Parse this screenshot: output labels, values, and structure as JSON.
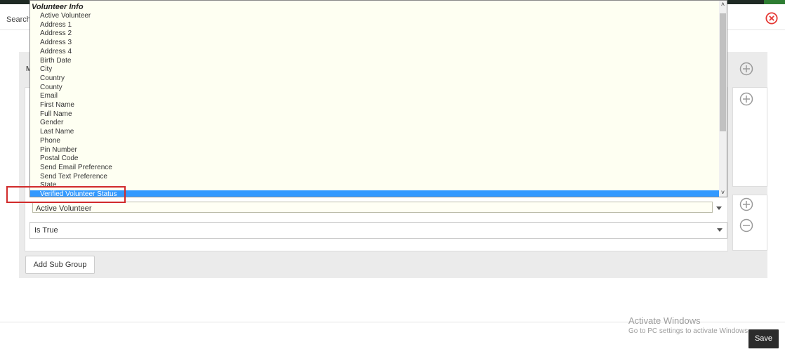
{
  "header": {
    "search_label": "Search",
    "close_color": "#e53935"
  },
  "panel": {
    "letter": "M"
  },
  "dropdown": {
    "group_label": "Volunteer Info",
    "items": [
      "Active Volunteer",
      "Address 1",
      "Address 2",
      "Address 3",
      "Address 4",
      "Birth Date",
      "City",
      "Country",
      "County",
      "Email",
      "First Name",
      "Full Name",
      "Gender",
      "Last Name",
      "Phone",
      "Pin Number",
      "Postal Code",
      "Send Email Preference",
      "Send Text Preference",
      "State",
      "Verified Volunteer Status"
    ],
    "selected_index": 20,
    "selected_color": "#3399ff",
    "highlight_color": "#d12b2b"
  },
  "condition": {
    "field_value": "Active Volunteer",
    "operator_value": "Is True"
  },
  "buttons": {
    "add_sub_group": "Add Sub Group",
    "save": "Save"
  },
  "watermark": {
    "title": "Activate Windows",
    "subtitle": "Go to PC settings to activate Windows."
  }
}
